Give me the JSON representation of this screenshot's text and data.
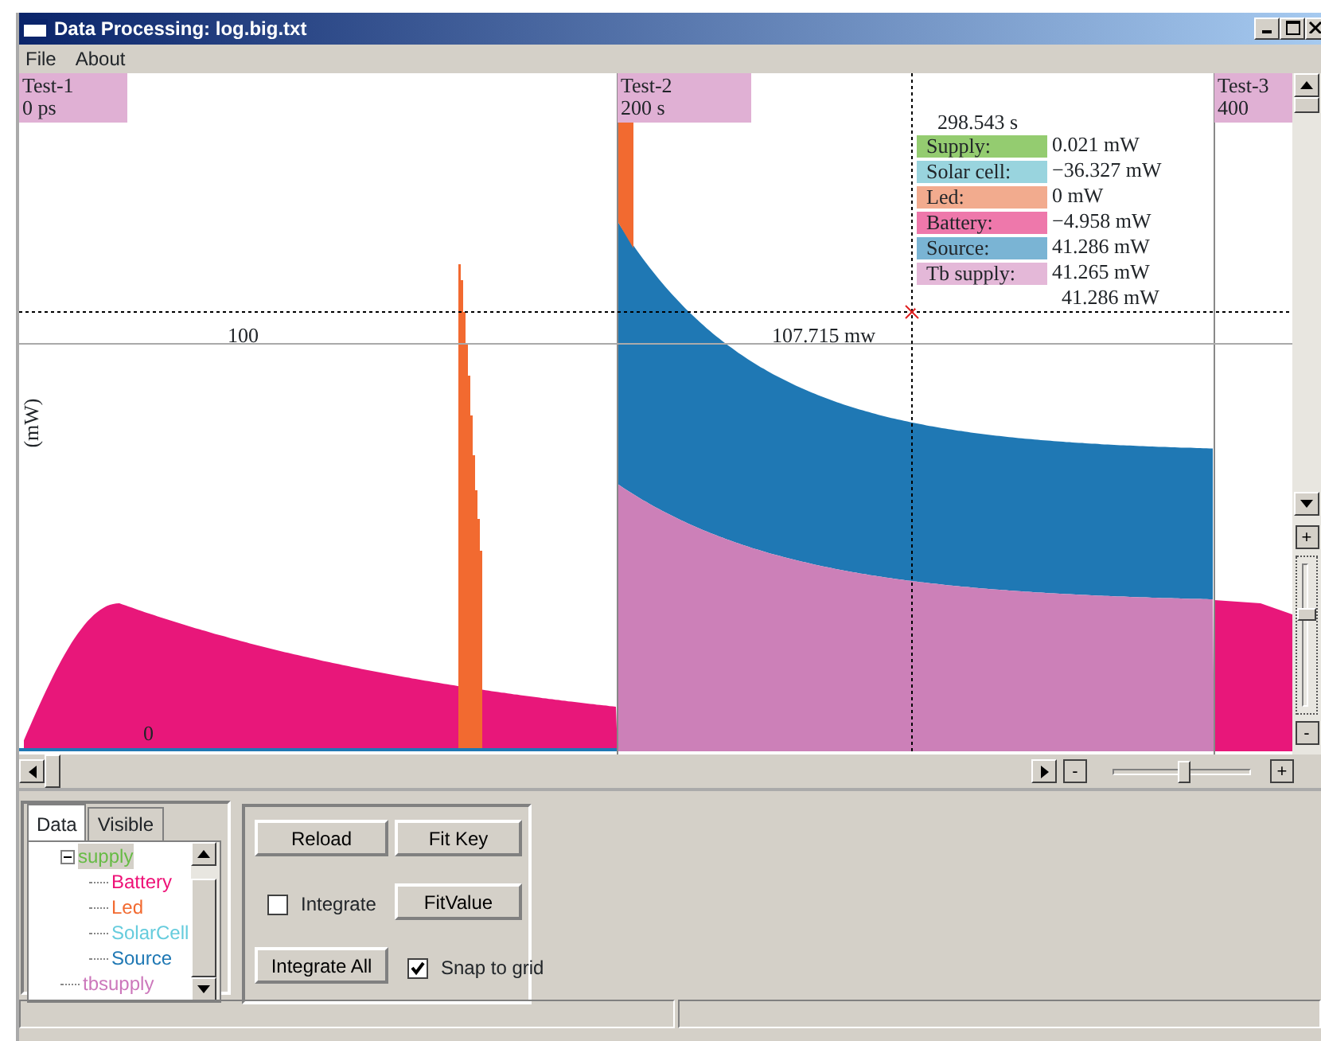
{
  "window": {
    "title": "Data Processing: log.big.txt"
  },
  "menu": [
    "File",
    "About"
  ],
  "markers": [
    {
      "label": "Test-1",
      "time": "0 ps"
    },
    {
      "label": "Test-2",
      "time": "200 s"
    },
    {
      "label": "Test-3",
      "time": "400"
    }
  ],
  "plot": {
    "y_label": "(mW)",
    "reference_labels": [
      "100",
      "107.715 mw"
    ],
    "zero_label": "0"
  },
  "cursor_readout": {
    "time": "298.543 s",
    "rows": [
      {
        "label": "Supply:",
        "value": "0.021 mW",
        "color": "#94cc70"
      },
      {
        "label": "Solar cell:",
        "value": "−36.327 mW",
        "color": "#99d4de"
      },
      {
        "label": "Led:",
        "value": "0 mW",
        "color": "#f2ab8e"
      },
      {
        "label": "Battery:",
        "value": "−4.958 mW",
        "color": "#ee78ab"
      },
      {
        "label": "Source:",
        "value": "41.286 mW",
        "color": "#7ab4d4"
      },
      {
        "label": "Tb supply:",
        "value": "41.265 mW",
        "color": "#e4b8d8"
      }
    ],
    "total": "41.286 mW"
  },
  "zoom": {
    "minus": "-",
    "plus": "+",
    "level": 0.53
  },
  "vertical_zoom": {
    "plus": "+",
    "minus": "-"
  },
  "tabs": [
    {
      "label": "Data",
      "selected": true
    },
    {
      "label": "Visible",
      "selected": false
    }
  ],
  "tree": [
    {
      "label": "supply",
      "color": "#66bb44",
      "selected": true,
      "expanded": true,
      "children": [
        {
          "label": "Battery",
          "color": "#ee1177"
        },
        {
          "label": "Led",
          "color": "#f26a30"
        },
        {
          "label": "SolarCell",
          "color": "#66ccdd"
        },
        {
          "label": "Source",
          "color": "#1f78b4"
        }
      ]
    },
    {
      "label": "tbsupply",
      "color": "#cc77bb",
      "selected": false
    }
  ],
  "buttons": [
    {
      "kind": "button",
      "label": "Reload"
    },
    {
      "kind": "button",
      "label": "Fit Key"
    },
    {
      "kind": "checkbox",
      "label": "Integrate",
      "checked": false
    },
    {
      "kind": "button",
      "label": "FitValue"
    },
    {
      "kind": "button",
      "label": "Integrate All"
    },
    {
      "kind": "checkbox",
      "label": "Snap to grid",
      "checked": true
    }
  ]
}
